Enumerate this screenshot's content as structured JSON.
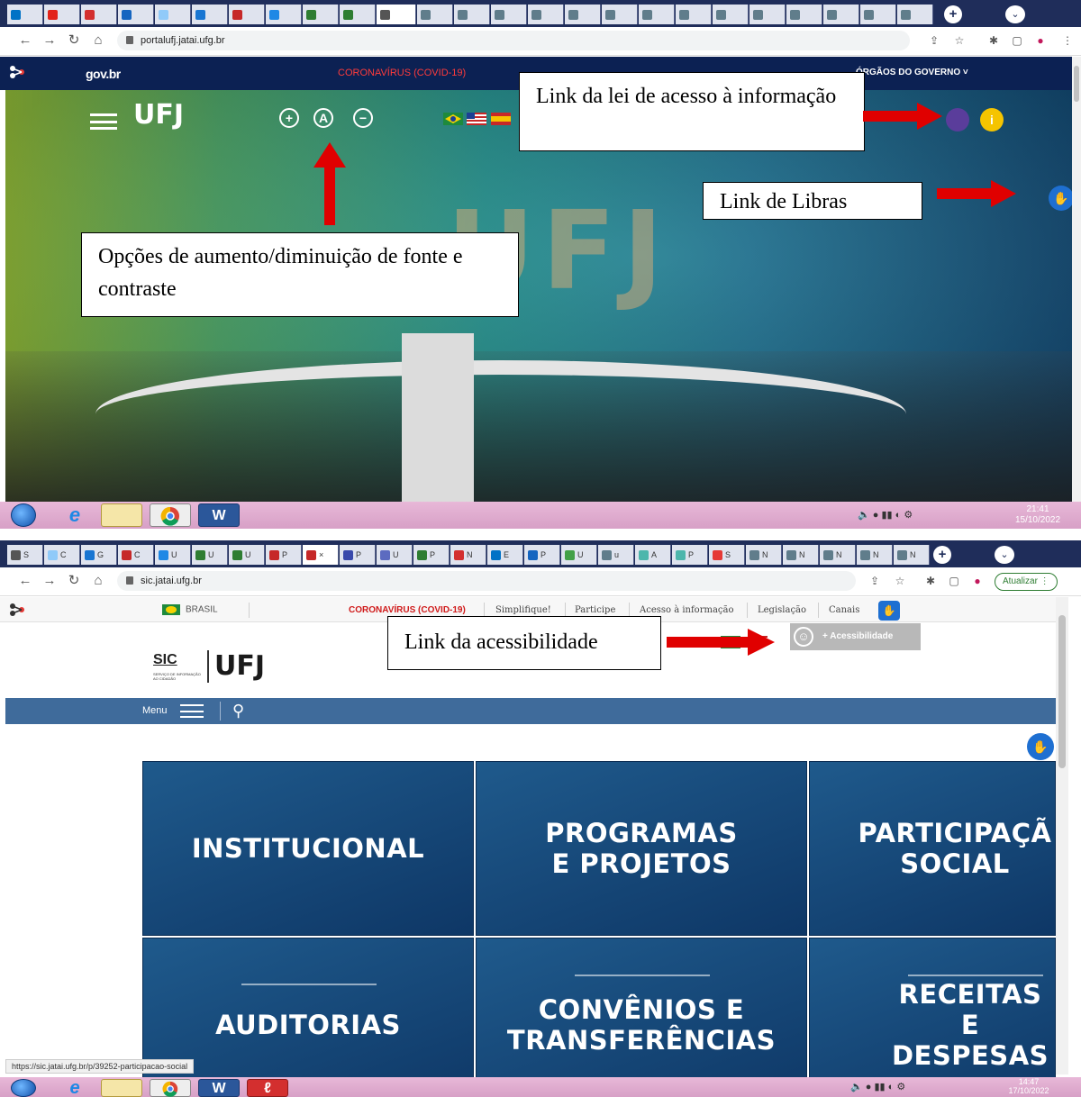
{
  "screenshot1": {
    "address": "portalufj.jatai.ufg.br",
    "govbar": {
      "logo": "gov.br",
      "covid": "CORONAVÍRUS (COVID-19)",
      "orgaos": "ÓRGÃOS DO GOVERNO ˅"
    },
    "site_logo": "UFJ",
    "font_buttons": [
      "+",
      "A",
      "−"
    ],
    "hero_letters": "UFJ",
    "info_icon": "i",
    "annotations": {
      "lei_acesso": "Link da lei de acesso à informação",
      "libras": "Link de Libras",
      "fonte": "Opções de aumento/diminuição de fonte e contraste"
    },
    "clock": {
      "time": "21:41",
      "date": "15/10/2022"
    }
  },
  "screenshot2": {
    "address": "sic.jatai.ufg.br",
    "update_button": "Atualizar",
    "govbar": {
      "brasil": "BRASIL",
      "covid": "CORONAVÍRUS (COVID-19)",
      "links": [
        "Simplifique!",
        "Participe",
        "Acesso à informação",
        "Legislação",
        "Canais"
      ]
    },
    "sic_logo": {
      "sic": "SIC",
      "subtitle": "SERVIÇO DE INFORMAÇÃO AO CIDADÃO",
      "ufj": "UFJ"
    },
    "accessibility_button": "+ Acessibilidade",
    "menu_label": "Menu",
    "tiles": [
      "INSTITUCIONAL",
      "PROGRAMAS E PROJETOS",
      "PARTICIPAÇÃ SOCIAL",
      "AUDITORIAS",
      "CONVÊNIOS E TRANSFERÊNCIAS",
      "RECEITAS E DESPESAS"
    ],
    "annotation": "Link da acessibilidade",
    "status_url": "https://sic.jatai.ufg.br/p/39252-participacao-social",
    "clock": {
      "time": "14:47",
      "date": "17/10/2022"
    }
  },
  "colors": {
    "tabstrip": "#1f2d5a",
    "govbar_dark": "#0c2153",
    "menubar": "#3f6b9b",
    "tile": "#1f5a8c",
    "arrow": "#e00000",
    "taskbar": "#d7a0c6"
  }
}
